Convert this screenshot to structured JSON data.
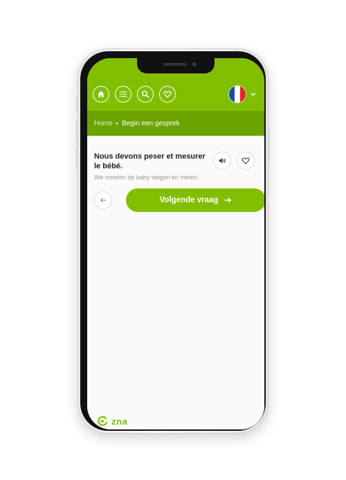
{
  "header": {
    "nav_icons": [
      "home-icon",
      "list-icon",
      "search-icon",
      "heart-icon"
    ],
    "language_flag": "france-flag",
    "colors": {
      "brand_green": "#82be00",
      "breadcrumb_green": "#6ba300"
    }
  },
  "breadcrumb": {
    "home": "Home",
    "current": "Begin een gesprek"
  },
  "question": {
    "text": "Nous devons peser et mesurer le bébé.",
    "translation": "We moeten de baby wegen en meten."
  },
  "actions": {
    "next_label": "Volgende vraag"
  },
  "footer": {
    "logo_text": "zna"
  }
}
